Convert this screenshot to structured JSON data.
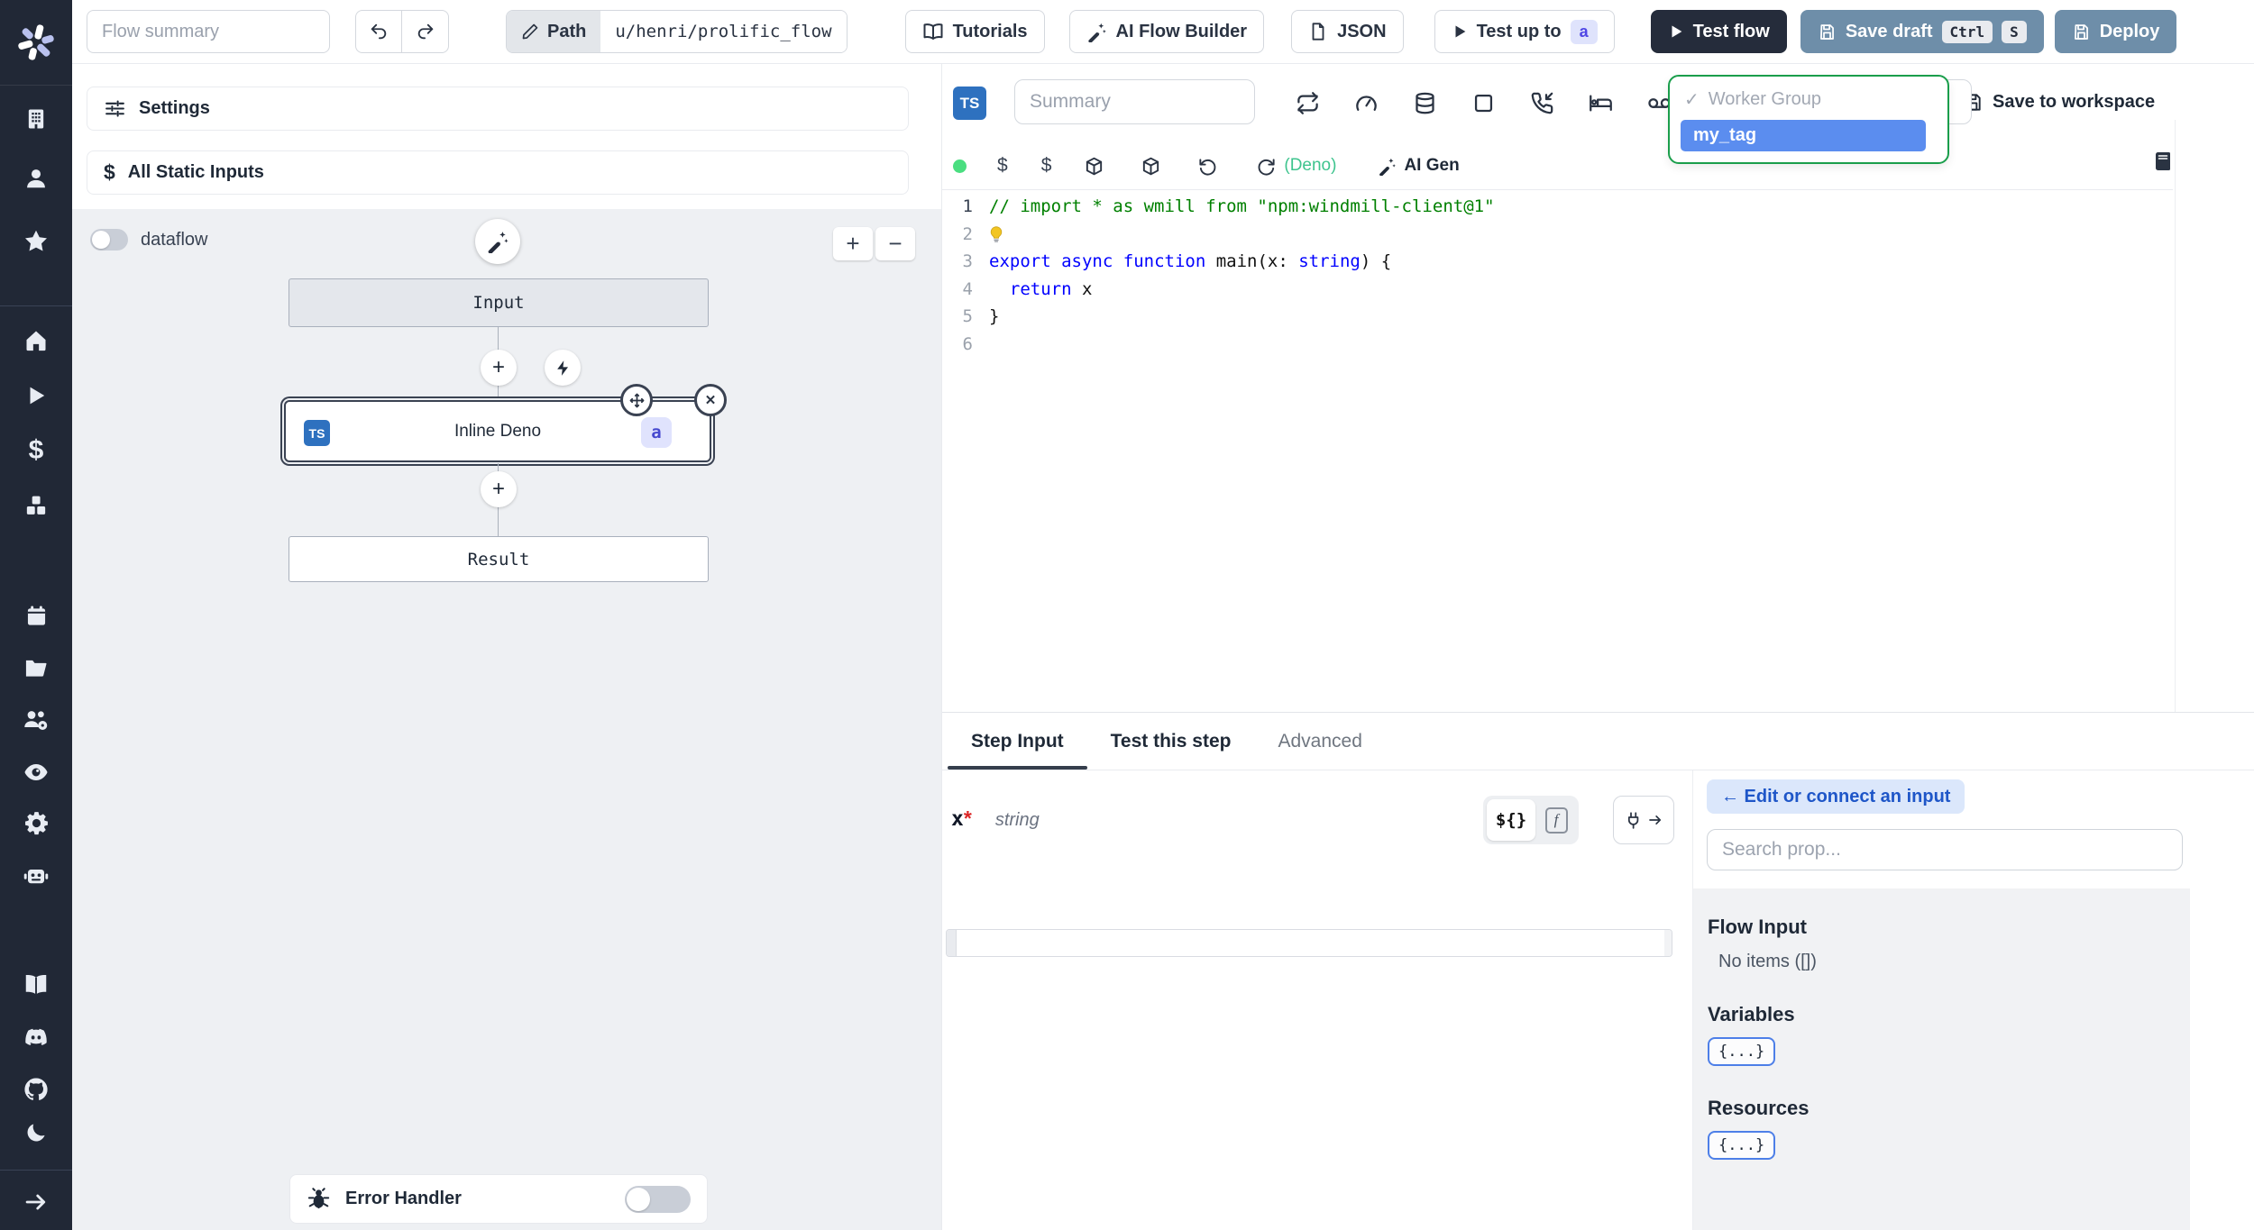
{
  "topbar": {
    "flow_summary_placeholder": "Flow summary",
    "path_label": "Path",
    "path_value": "u/henri/prolific_flow",
    "tutorials_label": "Tutorials",
    "ai_flow_builder_label": "AI Flow Builder",
    "json_label": "JSON",
    "test_up_to_label": "Test up to",
    "test_up_to_badge": "a",
    "test_flow_label": "Test flow",
    "save_draft_label": "Save draft",
    "save_draft_kbd": [
      "Ctrl",
      "S"
    ],
    "deploy_label": "Deploy"
  },
  "sidebar": {
    "icons": [
      "windmill-logo",
      "workspace-building",
      "user",
      "favorites-star",
      "home",
      "runs-play",
      "variables-dollar",
      "resources-cubes",
      "schedules-calendar",
      "folders",
      "groups-users",
      "audit-eye",
      "settings-gear",
      "workers-robot",
      "docs-book",
      "discord",
      "github",
      "dark-mode-moon",
      "expand-arrow"
    ]
  },
  "left_panel": {
    "settings_label": "Settings",
    "all_static_inputs_label": "All Static Inputs",
    "dataflow_label": "dataflow",
    "zoom_in": "+",
    "zoom_out": "−",
    "graph": {
      "input_node": "Input",
      "step_lang": "TS",
      "step_node": "Inline Deno",
      "step_badge": "a",
      "result_node": "Result"
    },
    "error_handler_label": "Error Handler"
  },
  "editor_panel": {
    "lang_badge": "TS",
    "summary_placeholder": "Summary",
    "worker_group_dropdown": {
      "check": "✓",
      "label": "Worker Group",
      "selected_option": "my_tag"
    },
    "save_to_workspace_label": "Save to workspace",
    "runtime_label": "(Deno)",
    "ai_gen_label": "AI Gen",
    "code": {
      "lines": [
        {
          "num": "1",
          "tokens": [
            {
              "text": "// import * as wmill from \"npm:windmill-client@1\"",
              "color": "comment"
            }
          ]
        },
        {
          "num": "2",
          "bulb": true,
          "tokens": []
        },
        {
          "num": "3",
          "tokens": [
            {
              "text": "export",
              "color": "keyword"
            },
            {
              "text": " ",
              "color": "plain"
            },
            {
              "text": "async",
              "color": "keyword"
            },
            {
              "text": " ",
              "color": "plain"
            },
            {
              "text": "function",
              "color": "keyword"
            },
            {
              "text": " main(x: ",
              "color": "plain"
            },
            {
              "text": "string",
              "color": "type"
            },
            {
              "text": ") {",
              "color": "plain"
            }
          ]
        },
        {
          "num": "4",
          "tokens": [
            {
              "text": "  ",
              "color": "plain"
            },
            {
              "text": "return",
              "color": "keyword"
            },
            {
              "text": " x",
              "color": "plain"
            }
          ]
        },
        {
          "num": "5",
          "tokens": [
            {
              "text": "}",
              "color": "plain"
            }
          ]
        },
        {
          "num": "6",
          "tokens": []
        }
      ]
    }
  },
  "step_panel": {
    "tabs": [
      {
        "label": "Step Input",
        "active": true
      },
      {
        "label": "Test this step",
        "active": false
      },
      {
        "label": "Advanced",
        "active": false
      }
    ],
    "arg": {
      "name": "x",
      "required_mark": "*",
      "type": "string",
      "template_toggle": "${}",
      "fn_toggle": "f"
    }
  },
  "connect_panel": {
    "edit_button_label": "← Edit or connect an input",
    "search_placeholder": "Search prop...",
    "sections": [
      {
        "title": "Flow Input",
        "empty": "No items ([])"
      },
      {
        "title": "Variables",
        "badge": "{...}"
      },
      {
        "title": "Resources",
        "badge": "{...}"
      }
    ]
  },
  "glyphs": {
    "dollar": "$",
    "plus": "+",
    "close": "✕"
  },
  "colors": {
    "rail_bg": "#212836",
    "dark_button": "#252c3b",
    "save_button": "#6e8ea9",
    "ts_badge": "#2e71bf",
    "badge_indigo_bg": "#dfe3fc",
    "badge_indigo_text": "#4f46e5",
    "dropdown_border": "#1a9e4b",
    "selected_option_bg": "#5b8def",
    "deno_green": "#3ec48e",
    "run_dot_green": "#4ade80",
    "required_red": "#dc2626",
    "link_blue": "#1e56c8",
    "graph_bg": "#eef0f3",
    "code_comment": "#008000",
    "code_keyword": "#0000ff"
  }
}
